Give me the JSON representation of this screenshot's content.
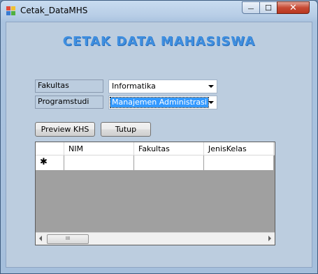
{
  "window": {
    "title": "Cetak_DataMHS",
    "minimize_glyph": "—",
    "maximize_glyph": "☐",
    "close_glyph": "✕"
  },
  "form": {
    "heading": "CETAK DATA MAHASISWA",
    "fakultas_label": "Fakultas",
    "fakultas_value": "Informatika",
    "programstudi_label": "Programstudi",
    "programstudi_value": "Manajemen Administrasi"
  },
  "buttons": {
    "preview_label": "Preview KHS",
    "close_label": "Tutup"
  },
  "grid": {
    "columns": [
      "NIM",
      "Fakultas",
      "JenisKelas"
    ],
    "new_row_marker": "✱",
    "scroll_thumb": "III"
  },
  "colors": {
    "heading": "#3f8fe0",
    "selection": "#3399ff",
    "close_button": "#c74a34"
  }
}
